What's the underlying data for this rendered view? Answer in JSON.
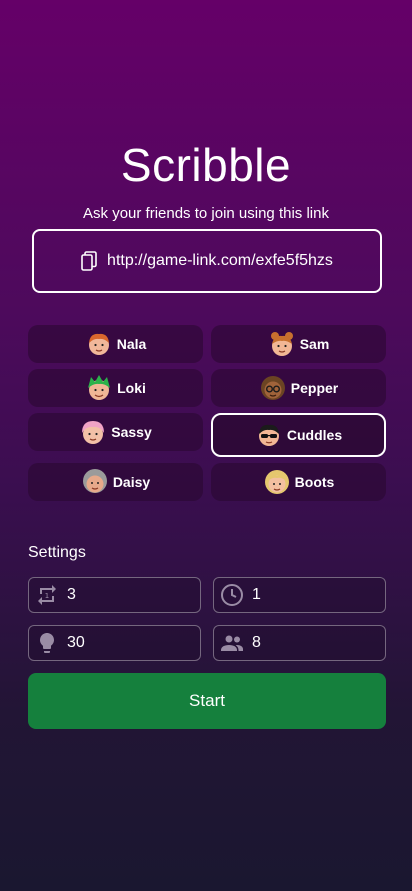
{
  "app": {
    "title": "Scribble",
    "subtitle": "Ask your friends to join using this link",
    "link": "http://game-link.com/exfe5f5hzs"
  },
  "players": [
    {
      "name": "Nala",
      "avatar": "red-hair-avatar",
      "hair": "#d9672d",
      "skin": "#f1b79a",
      "selected": false
    },
    {
      "name": "Sam",
      "avatar": "bun-hair-avatar",
      "hair": "#c8702e",
      "skin": "#f2b795",
      "selected": false
    },
    {
      "name": "Loki",
      "avatar": "green-hair-avatar",
      "hair": "#2bb24a",
      "skin": "#f0b796",
      "selected": false
    },
    {
      "name": "Pepper",
      "avatar": "curly-hair-glasses-avatar",
      "hair": "#6b4423",
      "skin": "#a0633a",
      "selected": false
    },
    {
      "name": "Sassy",
      "avatar": "pink-hair-avatar",
      "hair": "#f1a3c6",
      "skin": "#f3c0a7",
      "selected": false
    },
    {
      "name": "Cuddles",
      "avatar": "sunglasses-avatar",
      "hair": "#1b1b1b",
      "skin": "#f2b795",
      "selected": true
    },
    {
      "name": "Daisy",
      "avatar": "gray-hair-avatar",
      "hair": "#9b9b9b",
      "skin": "#e7a98a",
      "selected": false
    },
    {
      "name": "Boots",
      "avatar": "blonde-hair-avatar",
      "hair": "#e5c76e",
      "skin": "#f3c0a0",
      "selected": false
    }
  ],
  "settings": {
    "label": "Settings",
    "rounds": "3",
    "time": "1",
    "hints": "30",
    "players": "8"
  },
  "start_label": "Start",
  "colors": {
    "start": "#15803d",
    "field_border": "#75677f"
  }
}
